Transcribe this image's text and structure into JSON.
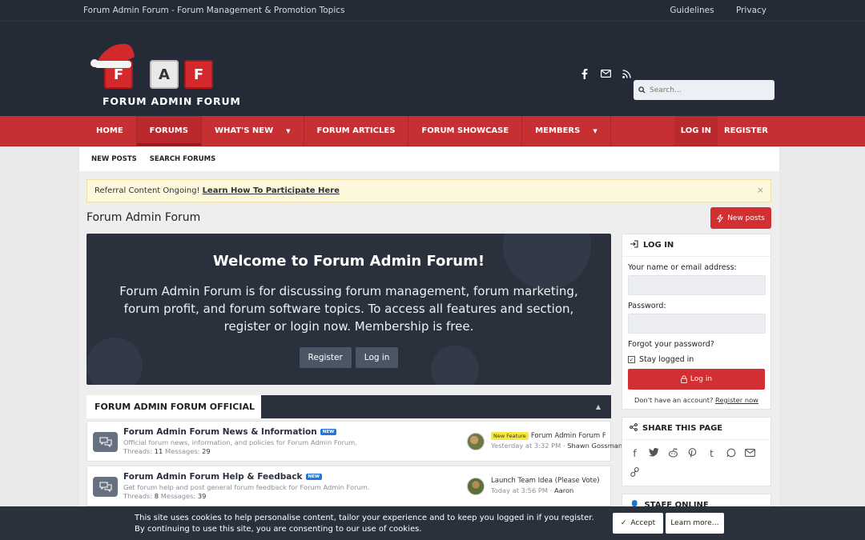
{
  "topbar": {
    "site_tagline": "Forum Admin Forum - Forum Management & Promotion Topics",
    "links": [
      "Guidelines",
      "Privacy"
    ]
  },
  "header": {
    "logo_letters": [
      "F",
      "A",
      "F"
    ],
    "logo_text": "FORUM ADMIN FORUM",
    "social_icons": [
      "facebook-icon",
      "mail-icon",
      "rss-icon"
    ],
    "search_placeholder": "Search…"
  },
  "nav": {
    "items": [
      {
        "label": "HOME"
      },
      {
        "label": "FORUMS"
      },
      {
        "label": "WHAT'S NEW"
      },
      {
        "label": "FORUM ARTICLES"
      },
      {
        "label": "FORUM SHOWCASE"
      },
      {
        "label": "MEMBERS"
      }
    ],
    "login": "LOG IN",
    "register": "REGISTER"
  },
  "subnav": {
    "items": [
      "NEW POSTS",
      "SEARCH FORUMS"
    ]
  },
  "notice": {
    "text": "Referral Content Ongoing!",
    "link": "Learn How To Participate Here",
    "close": "×"
  },
  "page": {
    "title": "Forum Admin Forum",
    "new_posts_button": "New posts"
  },
  "welcome": {
    "heading": "Welcome to Forum Admin Forum!",
    "body": "Forum Admin Forum is for discussing forum management, forum marketing, forum profit, and forum software topics. To access all features and section, register or login now. Membership is free.",
    "register_button": "Register",
    "login_button": "Log in"
  },
  "section": {
    "title": "FORUM ADMIN FORUM OFFICIAL"
  },
  "nodes": [
    {
      "title": "Forum Admin Forum News & Information",
      "badge": "NEW",
      "description": "Official forum news, information, and policies for Forum Admin Forum.",
      "threads_label": "Threads:",
      "threads": "11",
      "messages_label": "Messages:",
      "messages": "29",
      "latest_tag": "New Feature",
      "latest_title": "Forum Admin Forum F…",
      "latest_time": "Yesterday at 3:32 PM",
      "latest_user": "Shawn Gossman"
    },
    {
      "title": "Forum Admin Forum Help & Feedback",
      "badge": "NEW",
      "description": "Get forum help and post general forum feedback for Forum Admin Forum.",
      "threads_label": "Threads:",
      "threads": "8",
      "messages_label": "Messages:",
      "messages": "39",
      "latest_tag": "",
      "latest_title": "Launch Team Idea (Please Vote)",
      "latest_time": "Today at 3:56 PM",
      "latest_user": "Aaron"
    }
  ],
  "login_widget": {
    "title": "LOG IN",
    "name_label": "Your name or email address:",
    "password_label": "Password:",
    "forgot": "Forgot your password?",
    "stay": "Stay logged in",
    "button": "Log in",
    "no_account": "Don't have an account?",
    "register_now": "Register now"
  },
  "share_widget": {
    "title": "SHARE THIS PAGE",
    "icons": [
      "facebook-icon",
      "twitter-icon",
      "reddit-icon",
      "pinterest-icon",
      "tumblr-icon",
      "whatsapp-icon",
      "email-icon",
      "link-icon"
    ]
  },
  "staff_widget": {
    "title": "STAFF ONLINE"
  },
  "cookie": {
    "line1": "This site uses cookies to help personalise content, tailor your experience and to keep you logged in if you register.",
    "line2": "By continuing to use this site, you are consenting to our use of cookies.",
    "accept": "Accept",
    "learn_more": "Learn more…"
  }
}
